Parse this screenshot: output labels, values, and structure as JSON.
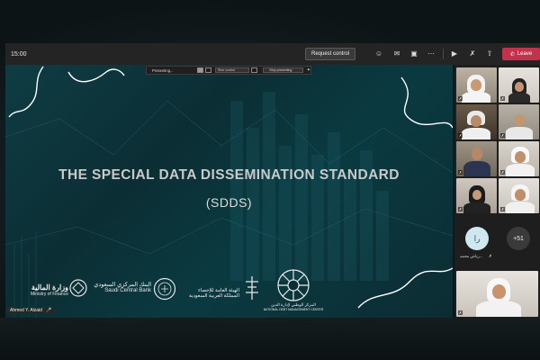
{
  "toolbar": {
    "timer": "15:00",
    "request_control_label": "Request control",
    "leave_label": "Leave",
    "colors": {
      "bar": "#242424",
      "leave": "#c4314b"
    },
    "icons": [
      "participants-icon",
      "chat-icon",
      "rooms-icon",
      "more-icon",
      "camera-icon",
      "mic-muted-icon",
      "share-icon"
    ]
  },
  "presenting_bar": {
    "label": "Presenting...",
    "give_control_label": "Give control",
    "stop_label": "Stop presenting"
  },
  "slide": {
    "title": "THE SPECIAL DATA DISSEMINATION STANDARD",
    "subtitle": "(SDDS)",
    "logos": [
      {
        "ar": "وزارة المالية",
        "en": "Ministry of Finance"
      },
      {
        "ar": "البنك المركزي السعودي",
        "en": "Saudi Central Bank"
      },
      {
        "ar": "الهيئة العامة للإحصاء",
        "ar2": "المملكة العربية السعودية"
      },
      {
        "ar": "المركز الوطني لإدارة الدين",
        "en": "NATIONAL DEBT MANAGEMENT CENTER"
      }
    ]
  },
  "presenter": {
    "name": "Ahmed Y. Alzaid"
  },
  "gallery": {
    "avatar_initials": "را",
    "avatar_name": "رياض محمد...",
    "overflow_count": "+51"
  }
}
